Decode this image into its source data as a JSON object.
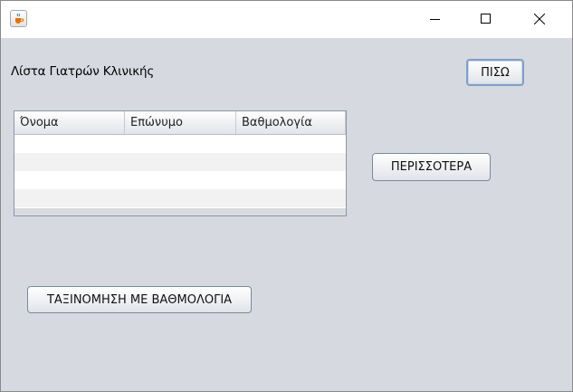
{
  "window": {
    "icon": "java-cup-icon",
    "controls": [
      "minimize-icon",
      "maximize-icon",
      "close-icon"
    ]
  },
  "content": {
    "title": "Λίστα Γιατρών Κλινικής",
    "back_label": "ΠΙΣΩ",
    "more_label": "ΠΕΡΙΣΣΟΤΕΡΑ",
    "sort_label": "ΤΑΞΙΝΟΜΗΣΗ ΜΕ ΒΑΘΜΟΛΟΓΙΑ"
  },
  "table": {
    "columns": [
      "Όνομα",
      "Επώνυμο",
      "Βαθμολογία"
    ],
    "rows": []
  },
  "colors": {
    "background": "#d6d9e0",
    "focus_border": "#7fa0c6"
  }
}
